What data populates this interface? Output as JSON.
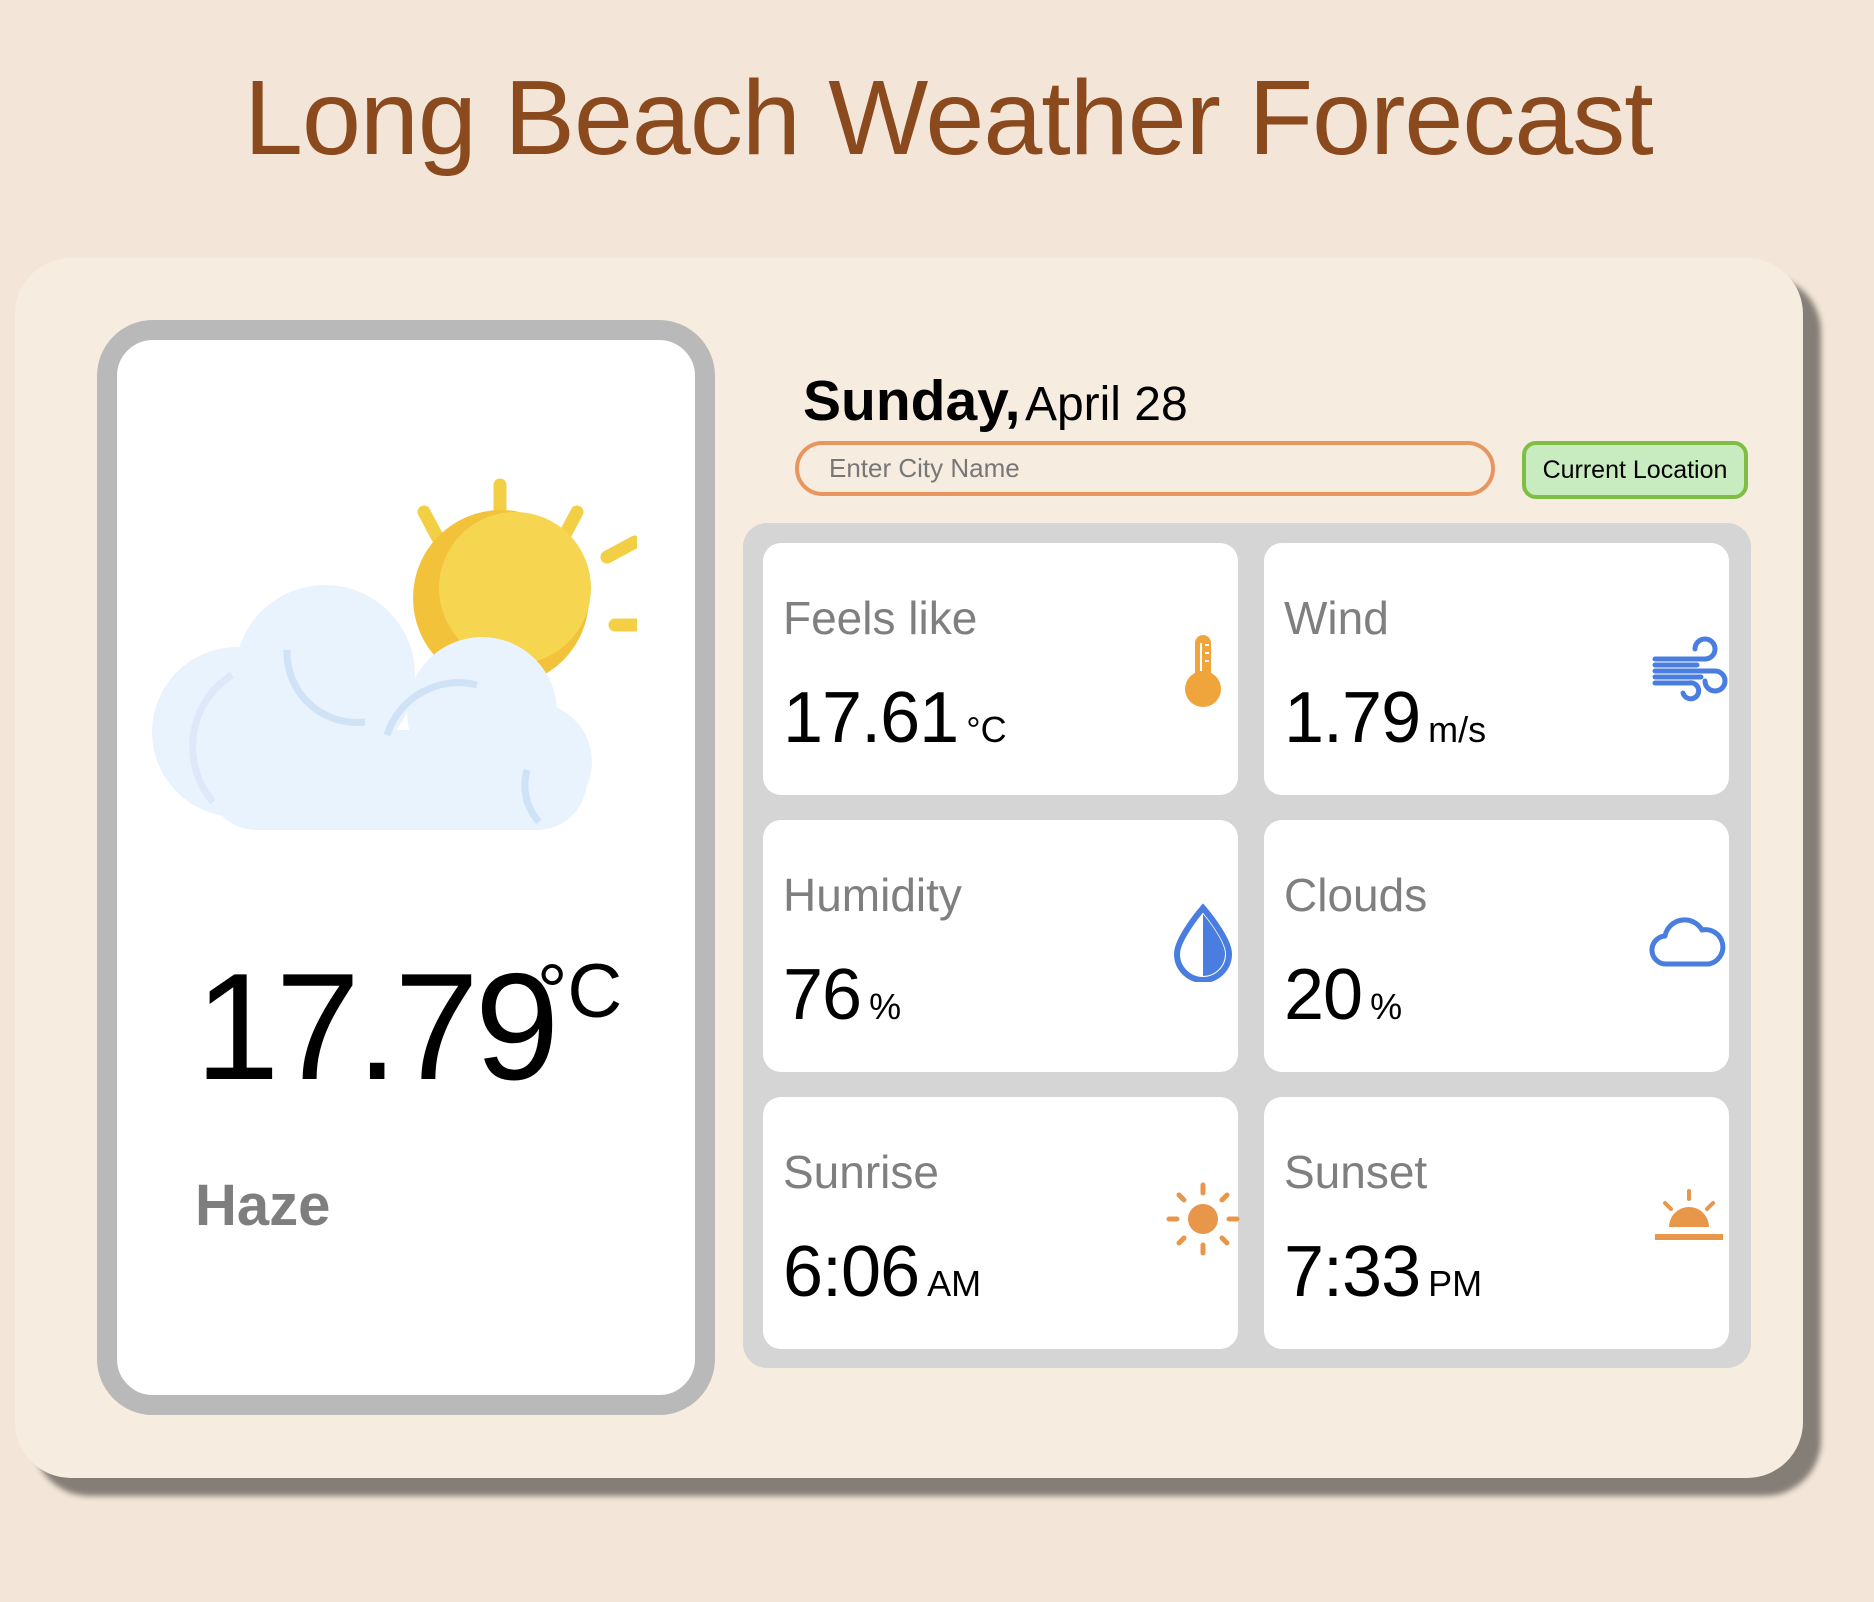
{
  "header": {
    "title": "Long Beach Weather Forecast"
  },
  "current": {
    "temperature": "17.79",
    "unit": "°C",
    "condition": "Haze",
    "icon": "partly-cloudy-sun-icon"
  },
  "date": {
    "day": "Sunday,",
    "rest": "April 28"
  },
  "search": {
    "placeholder": "Enter City Name",
    "value": ""
  },
  "location_button": {
    "label": "Current Location"
  },
  "stats": [
    {
      "label": "Feels like",
      "value": "17.61",
      "unit": "°C",
      "icon": "thermometer-icon",
      "icon_color": "#f0a43c"
    },
    {
      "label": "Wind",
      "value": "1.79",
      "unit": "m/s",
      "icon": "wind-icon",
      "icon_color": "#4a7de0"
    },
    {
      "label": "Humidity",
      "value": "76",
      "unit": "%",
      "icon": "water-drop-icon",
      "icon_color": "#4a7de0"
    },
    {
      "label": "Clouds",
      "value": "20",
      "unit": "%",
      "icon": "cloud-icon",
      "icon_color": "#4a7de0"
    },
    {
      "label": "Sunrise",
      "value": "6:06",
      "unit": "AM",
      "icon": "sun-icon",
      "icon_color": "#e8964a"
    },
    {
      "label": "Sunset",
      "value": "7:33",
      "unit": "PM",
      "icon": "sunset-icon",
      "icon_color": "#e8964a"
    }
  ],
  "colors": {
    "background": "#f3e6d8",
    "card": "#f7ece0",
    "title": "#8b4a1d",
    "input_border": "#e8955f",
    "button_bg": "#c8ebbf",
    "button_border": "#7fbe45"
  }
}
